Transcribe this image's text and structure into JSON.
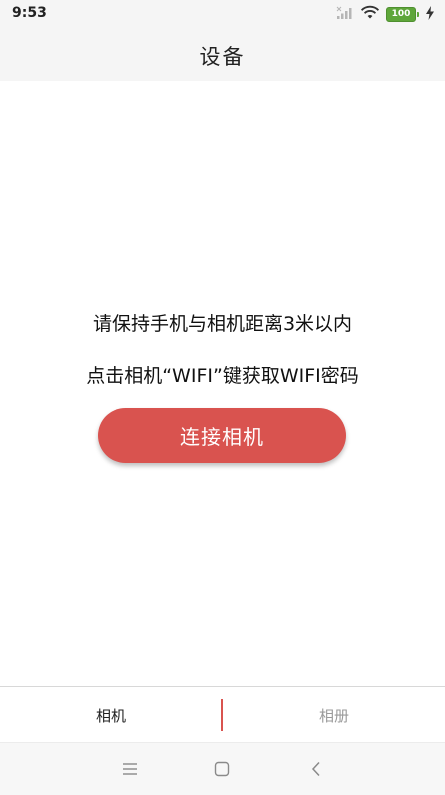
{
  "status_bar": {
    "time": "9:53",
    "battery_level": "100",
    "icons": [
      "signal-icon",
      "wifi-icon",
      "battery-icon",
      "charging-icon"
    ]
  },
  "header": {
    "title": "设备"
  },
  "main": {
    "instruction_1": "请保持手机与相机距离3米以内",
    "instruction_2": "点击相机“WIFI”键获取WIFI密码",
    "connect_button_label": "连接相机"
  },
  "tabs": [
    {
      "label": "相机",
      "active": true
    },
    {
      "label": "相册",
      "active": false
    }
  ],
  "nav_bar": {
    "icons": [
      "menu-icon",
      "home-icon",
      "back-icon"
    ]
  },
  "colors": {
    "accent": "#d9534f",
    "battery": "#5ea63a",
    "inactive_tab": "#9a9a9a"
  }
}
